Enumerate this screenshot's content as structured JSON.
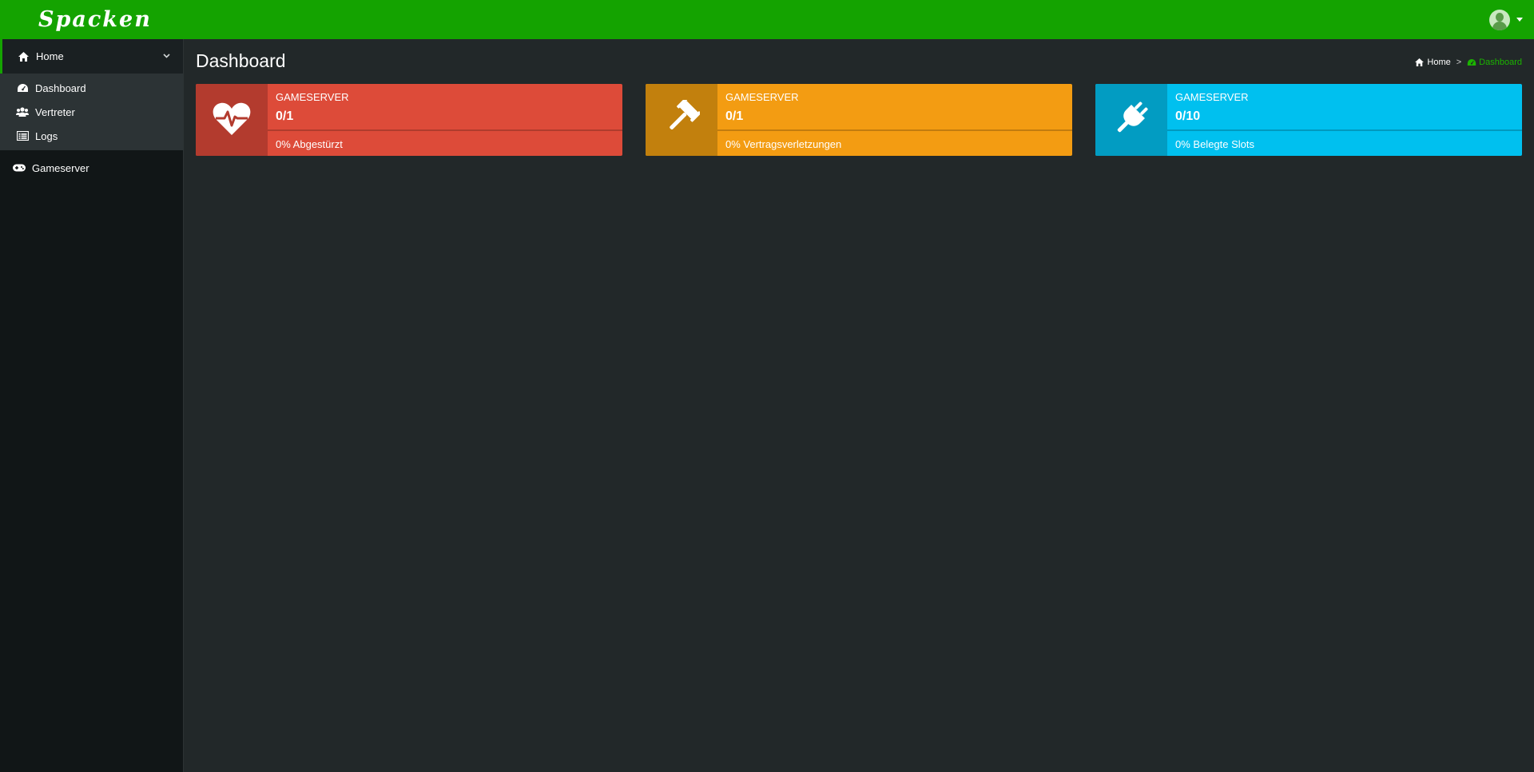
{
  "app": {
    "logo_text": "Spacken",
    "brand_color": "#14a300"
  },
  "header": {
    "user_avatar_icon": "user-avatar-icon",
    "dropdown_icon": "caret-down-icon"
  },
  "sidebar": {
    "home": {
      "label": "Home",
      "icon": "home-icon",
      "expanded": true
    },
    "sub_items": [
      {
        "label": "Dashboard",
        "icon": "dashboard-icon"
      },
      {
        "label": "Vertreter",
        "icon": "users-icon"
      },
      {
        "label": "Logs",
        "icon": "list-icon"
      }
    ],
    "items": [
      {
        "label": "Gameserver",
        "icon": "gamepad-icon"
      }
    ]
  },
  "main": {
    "title": "Dashboard",
    "breadcrumb": {
      "home": "Home",
      "separator": ">",
      "current": "Dashboard"
    },
    "info_boxes": [
      {
        "label": "GAMESERVER",
        "number": "0/1",
        "progress_percent": 0,
        "description": "0% Abgestürzt",
        "icon": "heartbeat-icon",
        "bg_color": "#dd4b39",
        "icon_bg_color": "#b33b2e"
      },
      {
        "label": "GAMESERVER",
        "number": "0/1",
        "progress_percent": 0,
        "description": "0% Vertragsverletzungen",
        "icon": "gavel-icon",
        "bg_color": "#f39c12",
        "icon_bg_color": "#c2800d"
      },
      {
        "label": "GAMESERVER",
        "number": "0/10",
        "progress_percent": 0,
        "description": "0% Belegte Slots",
        "icon": "plug-icon",
        "bg_color": "#00c0ef",
        "icon_bg_color": "#029cc2"
      }
    ]
  }
}
